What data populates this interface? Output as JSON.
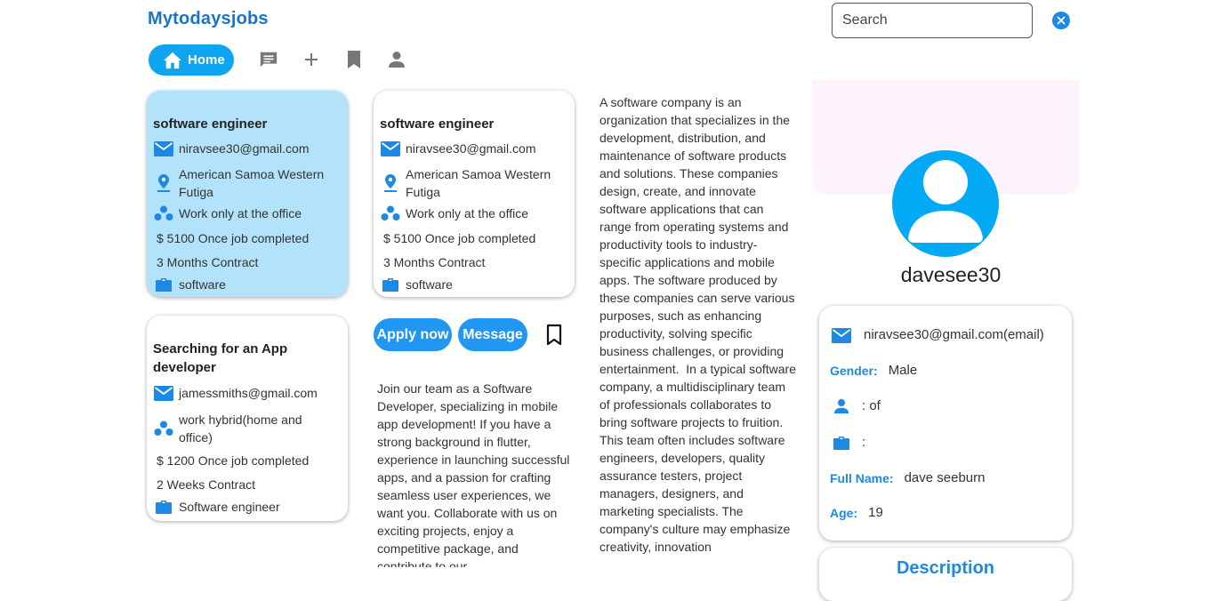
{
  "header": {
    "logo": "Mytodaysjobs",
    "search_placeholder": "Search"
  },
  "nav": {
    "home_label": "Home"
  },
  "jobs": [
    {
      "title": "software engineer",
      "email": "niravsee30@gmail.com",
      "location": "American Samoa Western Futiga",
      "work_mode": "Work only at the office",
      "pay": "$ 5100 Once job completed",
      "duration": "3 Months Contract",
      "category": "software"
    },
    {
      "title": "software engineer",
      "email": "niravsee30@gmail.com",
      "location": "American Samoa Western Futiga",
      "work_mode": "Work only at the office",
      "pay": "$ 5100 Once job completed",
      "duration": "3 Months Contract",
      "category": "software"
    },
    {
      "title": "Searching for an App developer",
      "email": "jamessmiths@gmail.com",
      "work_mode": "work hybrid(home and office)",
      "pay": "$ 1200 Once job completed",
      "duration": "2 Weeks Contract",
      "category": "Software engineer"
    }
  ],
  "actions": {
    "apply_label": "Apply now",
    "message_label": "Message"
  },
  "job_description": "Join our team as a Software Developer, specializing in mobile app development! If you have a strong background in flutter, experience in launching successful apps, and a passion for crafting seamless user experiences, we want you. Collaborate with us on exciting projects, enjoy a competitive package, and contribute to our",
  "company_description": "A software company is an organization that specializes in the development, distribution, and maintenance of software products and solutions. These companies design, create, and innovate software applications that can range from operating systems and productivity tools to industry-specific applications and mobile apps. The software produced by these companies can serve various purposes, such as enhancing productivity, solving specific business challenges, or providing entertainment.  In a typical software company, a multidisciplinary team of professionals collaborates to bring software projects to fruition. This team often includes software engineers, developers, quality assurance testers, project managers, designers, and marketing specialists. The company's culture may emphasize creativity, innovation",
  "profile": {
    "username": "davesee30",
    "email": "niravsee30@gmail.com(email)",
    "gender_label": "Gender:",
    "gender": "Male",
    "role": ":  of",
    "job": ":",
    "fullname_label": "Full Name:",
    "fullname": "dave seeburn",
    "age_label": "Age:",
    "age": "19",
    "description_title": "Description"
  },
  "colors": {
    "accent": "#1e88e5",
    "home_pill": "#0ea5f0",
    "selected_card": "#b3e3fa",
    "avatar": "#03a9f4",
    "banner": "#fcf3fd"
  }
}
